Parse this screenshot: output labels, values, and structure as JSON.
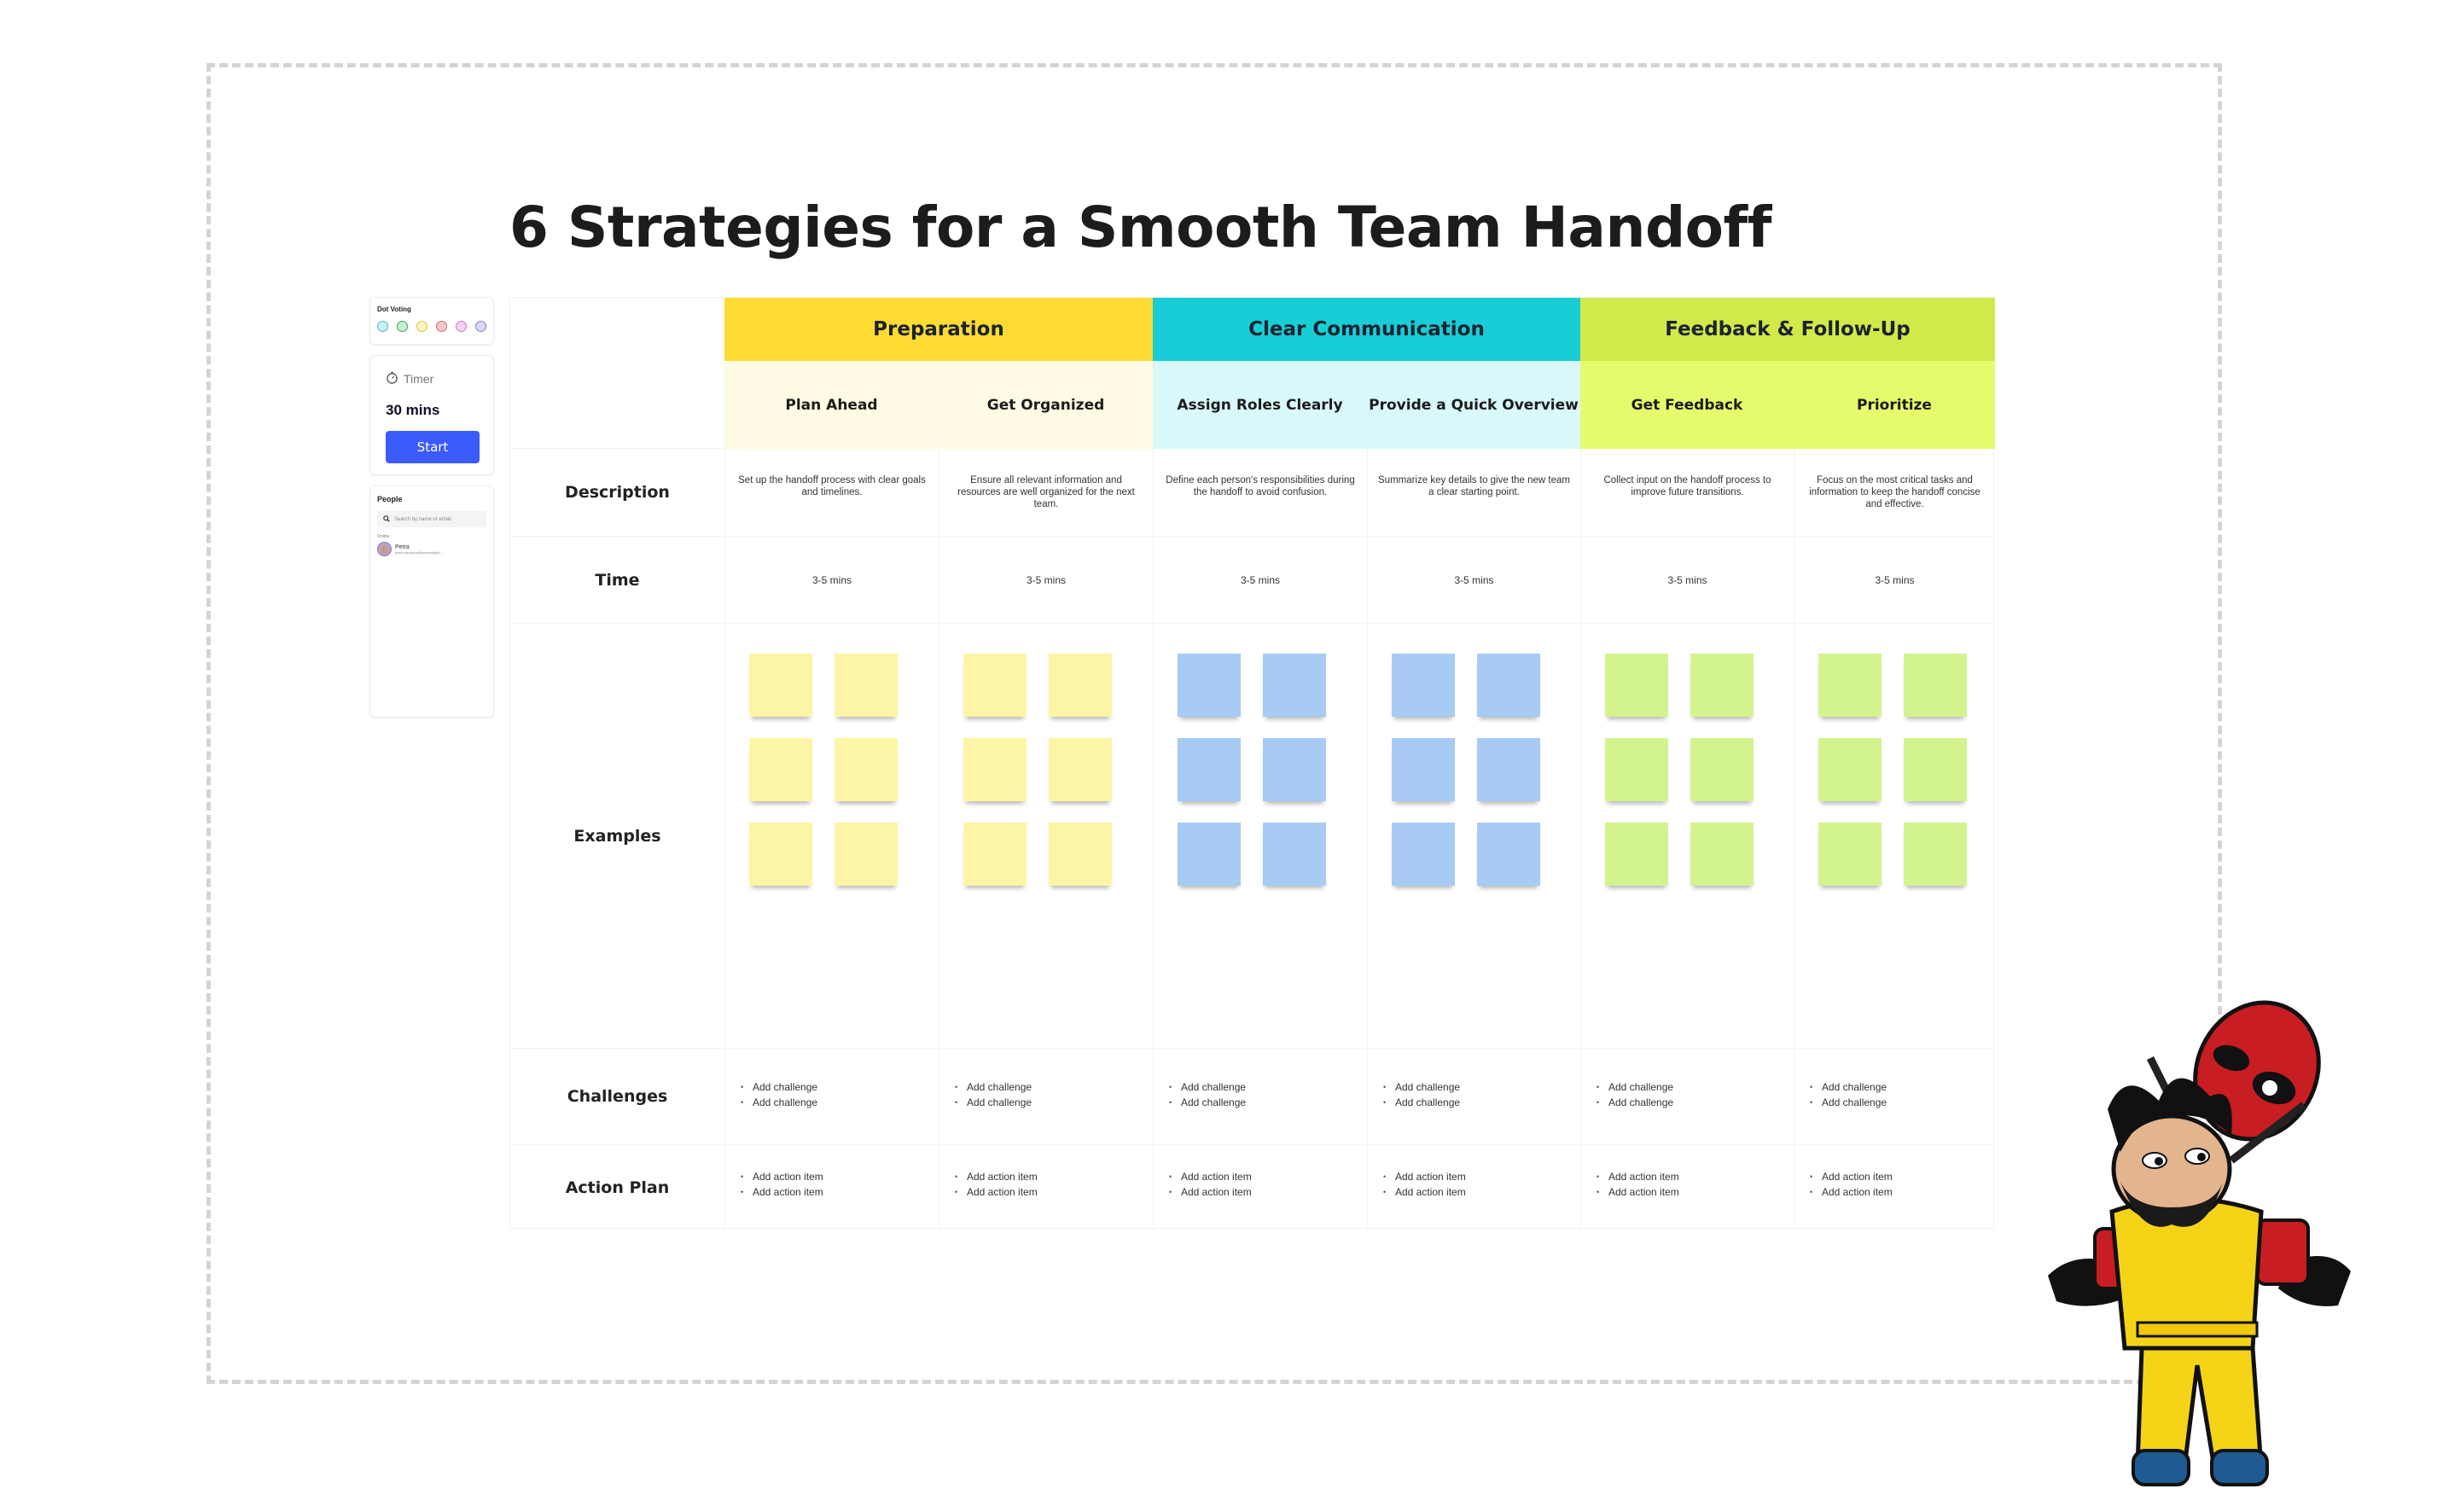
{
  "page": {
    "title": "6 Strategies for a Smooth Team Handoff"
  },
  "sidebar": {
    "dot_voting": {
      "label": "Dot Voting",
      "dots": [
        {
          "name": "cyan",
          "fill": "#c9f0f7",
          "stroke": "#59b8c9"
        },
        {
          "name": "green",
          "fill": "#c8f2d2",
          "stroke": "#3ea55d"
        },
        {
          "name": "yellow",
          "fill": "#fbf5b8",
          "stroke": "#d8c64a"
        },
        {
          "name": "red",
          "fill": "#f8c9cb",
          "stroke": "#d7676d"
        },
        {
          "name": "pink",
          "fill": "#f8d0f3",
          "stroke": "#cf78c4"
        },
        {
          "name": "purple",
          "fill": "#ddd9f7",
          "stroke": "#8a80cc"
        }
      ]
    },
    "timer": {
      "label": "Timer",
      "value": "30 mins",
      "start_label": "Start",
      "accent": "#3b5bfd"
    },
    "people": {
      "label": "People",
      "search_placeholder": "Search by name or email",
      "online_label": "Online",
      "members": [
        {
          "name": "Petra",
          "email": "petra.ivanigova@actumdigital..."
        }
      ]
    }
  },
  "board": {
    "row_labels": {
      "description": "Description",
      "time": "Time",
      "examples": "Examples",
      "challenges": "Challenges",
      "action_plan": "Action Plan"
    },
    "groups": [
      {
        "label": "Preparation",
        "color": "#fedb33",
        "sub_color": "#fffae3",
        "note_color": "#fdf5a6"
      },
      {
        "label": "Clear Communication",
        "color": "#19cdd6",
        "sub_color": "#d9f8fa",
        "note_color": "#a7cbf2"
      },
      {
        "label": "Feedback & Follow-Up",
        "color": "#d2e94a",
        "sub_color": "#e6fb6c",
        "note_color": "#d3f38f"
      }
    ],
    "strategies": [
      {
        "group": 0,
        "title": "Plan Ahead",
        "description": "Set up the handoff process with clear goals and timelines.",
        "time": "3-5 mins",
        "challenges": [
          "Add challenge",
          "Add challenge"
        ],
        "actions": [
          "Add action item",
          "Add action item"
        ]
      },
      {
        "group": 0,
        "title": "Get Organized",
        "description": "Ensure all relevant information and resources are well organized for the next team.",
        "time": "3-5 mins",
        "challenges": [
          "Add challenge",
          "Add challenge"
        ],
        "actions": [
          "Add action item",
          "Add action item"
        ]
      },
      {
        "group": 1,
        "title": "Assign Roles Clearly",
        "description": "Define each person's responsibilities during the handoff to avoid confusion.",
        "time": "3-5 mins",
        "challenges": [
          "Add challenge",
          "Add challenge"
        ],
        "actions": [
          "Add action item",
          "Add action item"
        ]
      },
      {
        "group": 1,
        "title": "Provide a Quick Overview",
        "description": "Summarize key details to give the new team a clear starting point.",
        "time": "3-5 mins",
        "challenges": [
          "Add challenge",
          "Add challenge"
        ],
        "actions": [
          "Add action item",
          "Add action item"
        ]
      },
      {
        "group": 2,
        "title": "Get Feedback",
        "description": "Collect input on the handoff process to improve future transitions.",
        "time": "3-5 mins",
        "challenges": [
          "Add challenge",
          "Add challenge"
        ],
        "actions": [
          "Add action item",
          "Add action item"
        ]
      },
      {
        "group": 2,
        "title": "Prioritize",
        "description": "Focus on the most critical tasks and information to keep the handoff concise and effective.",
        "time": "3-5 mins",
        "challenges": [
          "Add challenge",
          "Add challenge"
        ],
        "actions": [
          "Add action item",
          "Add action item"
        ]
      }
    ],
    "sticky_notes_per_column": 6
  },
  "decoration": {
    "sticker": "cartoon-character-sticker"
  }
}
